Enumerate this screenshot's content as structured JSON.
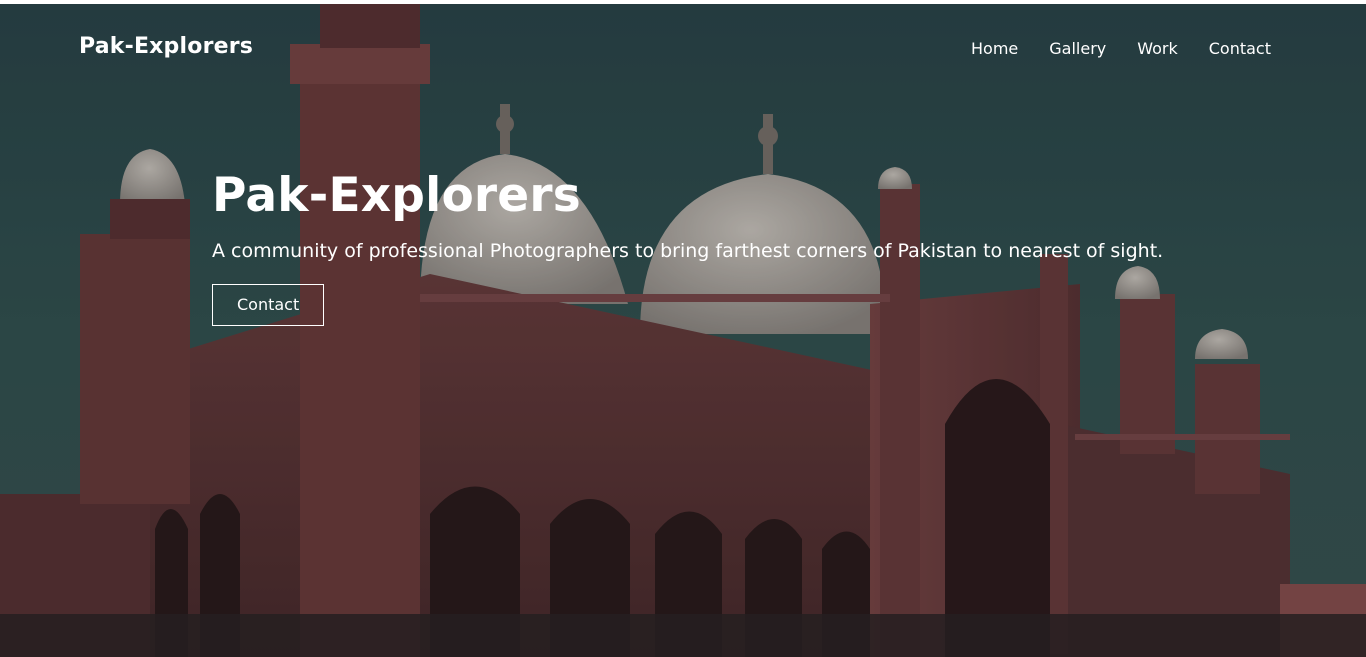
{
  "navbar": {
    "brand": "Pak-Explorers",
    "links": [
      "Home",
      "Gallery",
      "Work",
      "Contact"
    ]
  },
  "hero": {
    "title": "Pak-Explorers",
    "subtitle": "A community of professional Photographers to bring farthest corners of Pakistan to nearest of sight.",
    "cta_label": "Contact"
  },
  "colors": {
    "sky": "#2f4a4e",
    "building": "#6e3a3a",
    "dome": "#c9bfb8",
    "text": "#ffffff"
  }
}
